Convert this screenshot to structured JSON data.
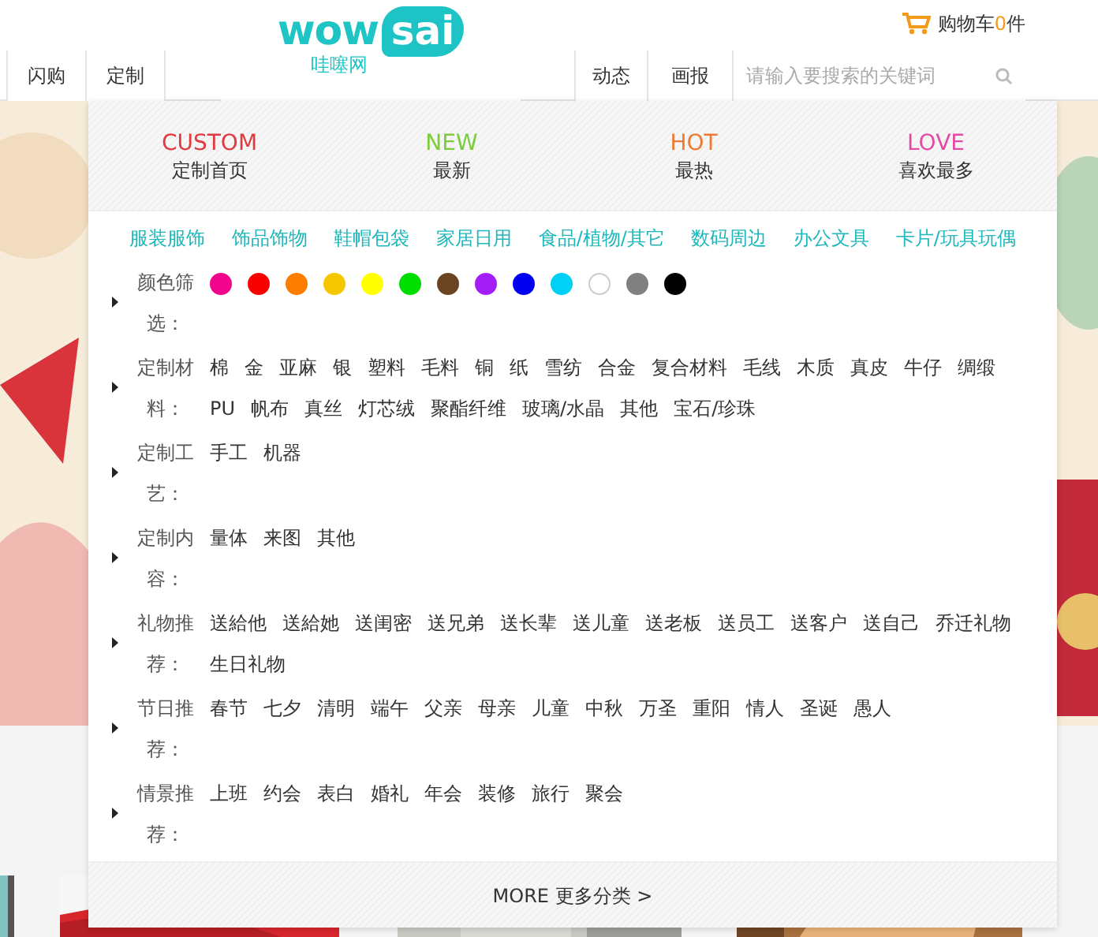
{
  "header": {
    "logo": {
      "word": "wow",
      "badge": "sai",
      "subtitle": "哇噻网"
    },
    "cart": {
      "label": "购物车",
      "count": "0",
      "unit": "件"
    }
  },
  "nav": {
    "left": [
      {
        "label": "闪购"
      },
      {
        "label": "定制"
      }
    ],
    "right": [
      {
        "label": "动态"
      },
      {
        "label": "画报"
      }
    ],
    "search": {
      "placeholder": "请输入要搜索的关键词"
    }
  },
  "dropdown": {
    "featured": [
      {
        "title": "CUSTOM",
        "subtitle": "定制首页",
        "color": "#e0393e"
      },
      {
        "title": "NEW",
        "subtitle": "最新",
        "color": "#7ccd3c"
      },
      {
        "title": "HOT",
        "subtitle": "最热",
        "color": "#ee7b35"
      },
      {
        "title": "LOVE",
        "subtitle": "喜欢最多",
        "color": "#e44ba6"
      }
    ],
    "categories": [
      "服装服饰",
      "饰品饰物",
      "鞋帽包袋",
      "家居日用",
      "食品/植物/其它",
      "数码周边",
      "办公文具",
      "卡片/玩具玩偶"
    ],
    "filters": [
      {
        "kind": "colors",
        "label": "颜色筛选：",
        "colors": [
          {
            "color": "#f0058b"
          },
          {
            "color": "#f80000"
          },
          {
            "color": "#fb7e00"
          },
          {
            "color": "#f4c700"
          },
          {
            "color": "#ffff00"
          },
          {
            "color": "#00dd00"
          },
          {
            "color": "#6b4423"
          },
          {
            "color": "#a41df6"
          },
          {
            "color": "#0000f0"
          },
          {
            "color": "#00d0f6"
          },
          {
            "color": "#ffffff"
          },
          {
            "color": "#808080"
          },
          {
            "color": "#000000"
          }
        ]
      },
      {
        "kind": "tags",
        "label": "定制材料：",
        "items": [
          "棉",
          "金",
          "亚麻",
          "银",
          "塑料",
          "毛料",
          "铜",
          "纸",
          "雪纺",
          "合金",
          "复合材料",
          "毛线",
          "木质",
          "真皮",
          "牛仔",
          "绸缎",
          "PU",
          "帆布",
          "真丝",
          "灯芯绒",
          "聚酯纤维",
          "玻璃/水晶",
          "其他",
          "宝石/珍珠"
        ]
      },
      {
        "kind": "tags",
        "label": "定制工艺：",
        "items": [
          "手工",
          "机器"
        ]
      },
      {
        "kind": "tags",
        "label": "定制内容：",
        "items": [
          "量体",
          "来图",
          "其他"
        ]
      },
      {
        "kind": "tags",
        "label": "礼物推荐：",
        "items": [
          "送給他",
          "送給她",
          "送闺密",
          "送兄弟",
          "送长辈",
          "送儿童",
          "送老板",
          "送员工",
          "送客户",
          "送自己",
          "乔迁礼物",
          "生日礼物"
        ]
      },
      {
        "kind": "tags",
        "label": "节日推荐：",
        "items": [
          "春节",
          "七夕",
          "清明",
          "端午",
          "父亲",
          "母亲",
          "儿童",
          "中秋",
          "万圣",
          "重阳",
          "情人",
          "圣诞",
          "愚人"
        ]
      },
      {
        "kind": "tags",
        "label": "情景推荐：",
        "items": [
          "上班",
          "约会",
          "表白",
          "婚礼",
          "年会",
          "装修",
          "旅行",
          "聚会"
        ]
      }
    ],
    "more": "MORE 更多分类 >"
  }
}
